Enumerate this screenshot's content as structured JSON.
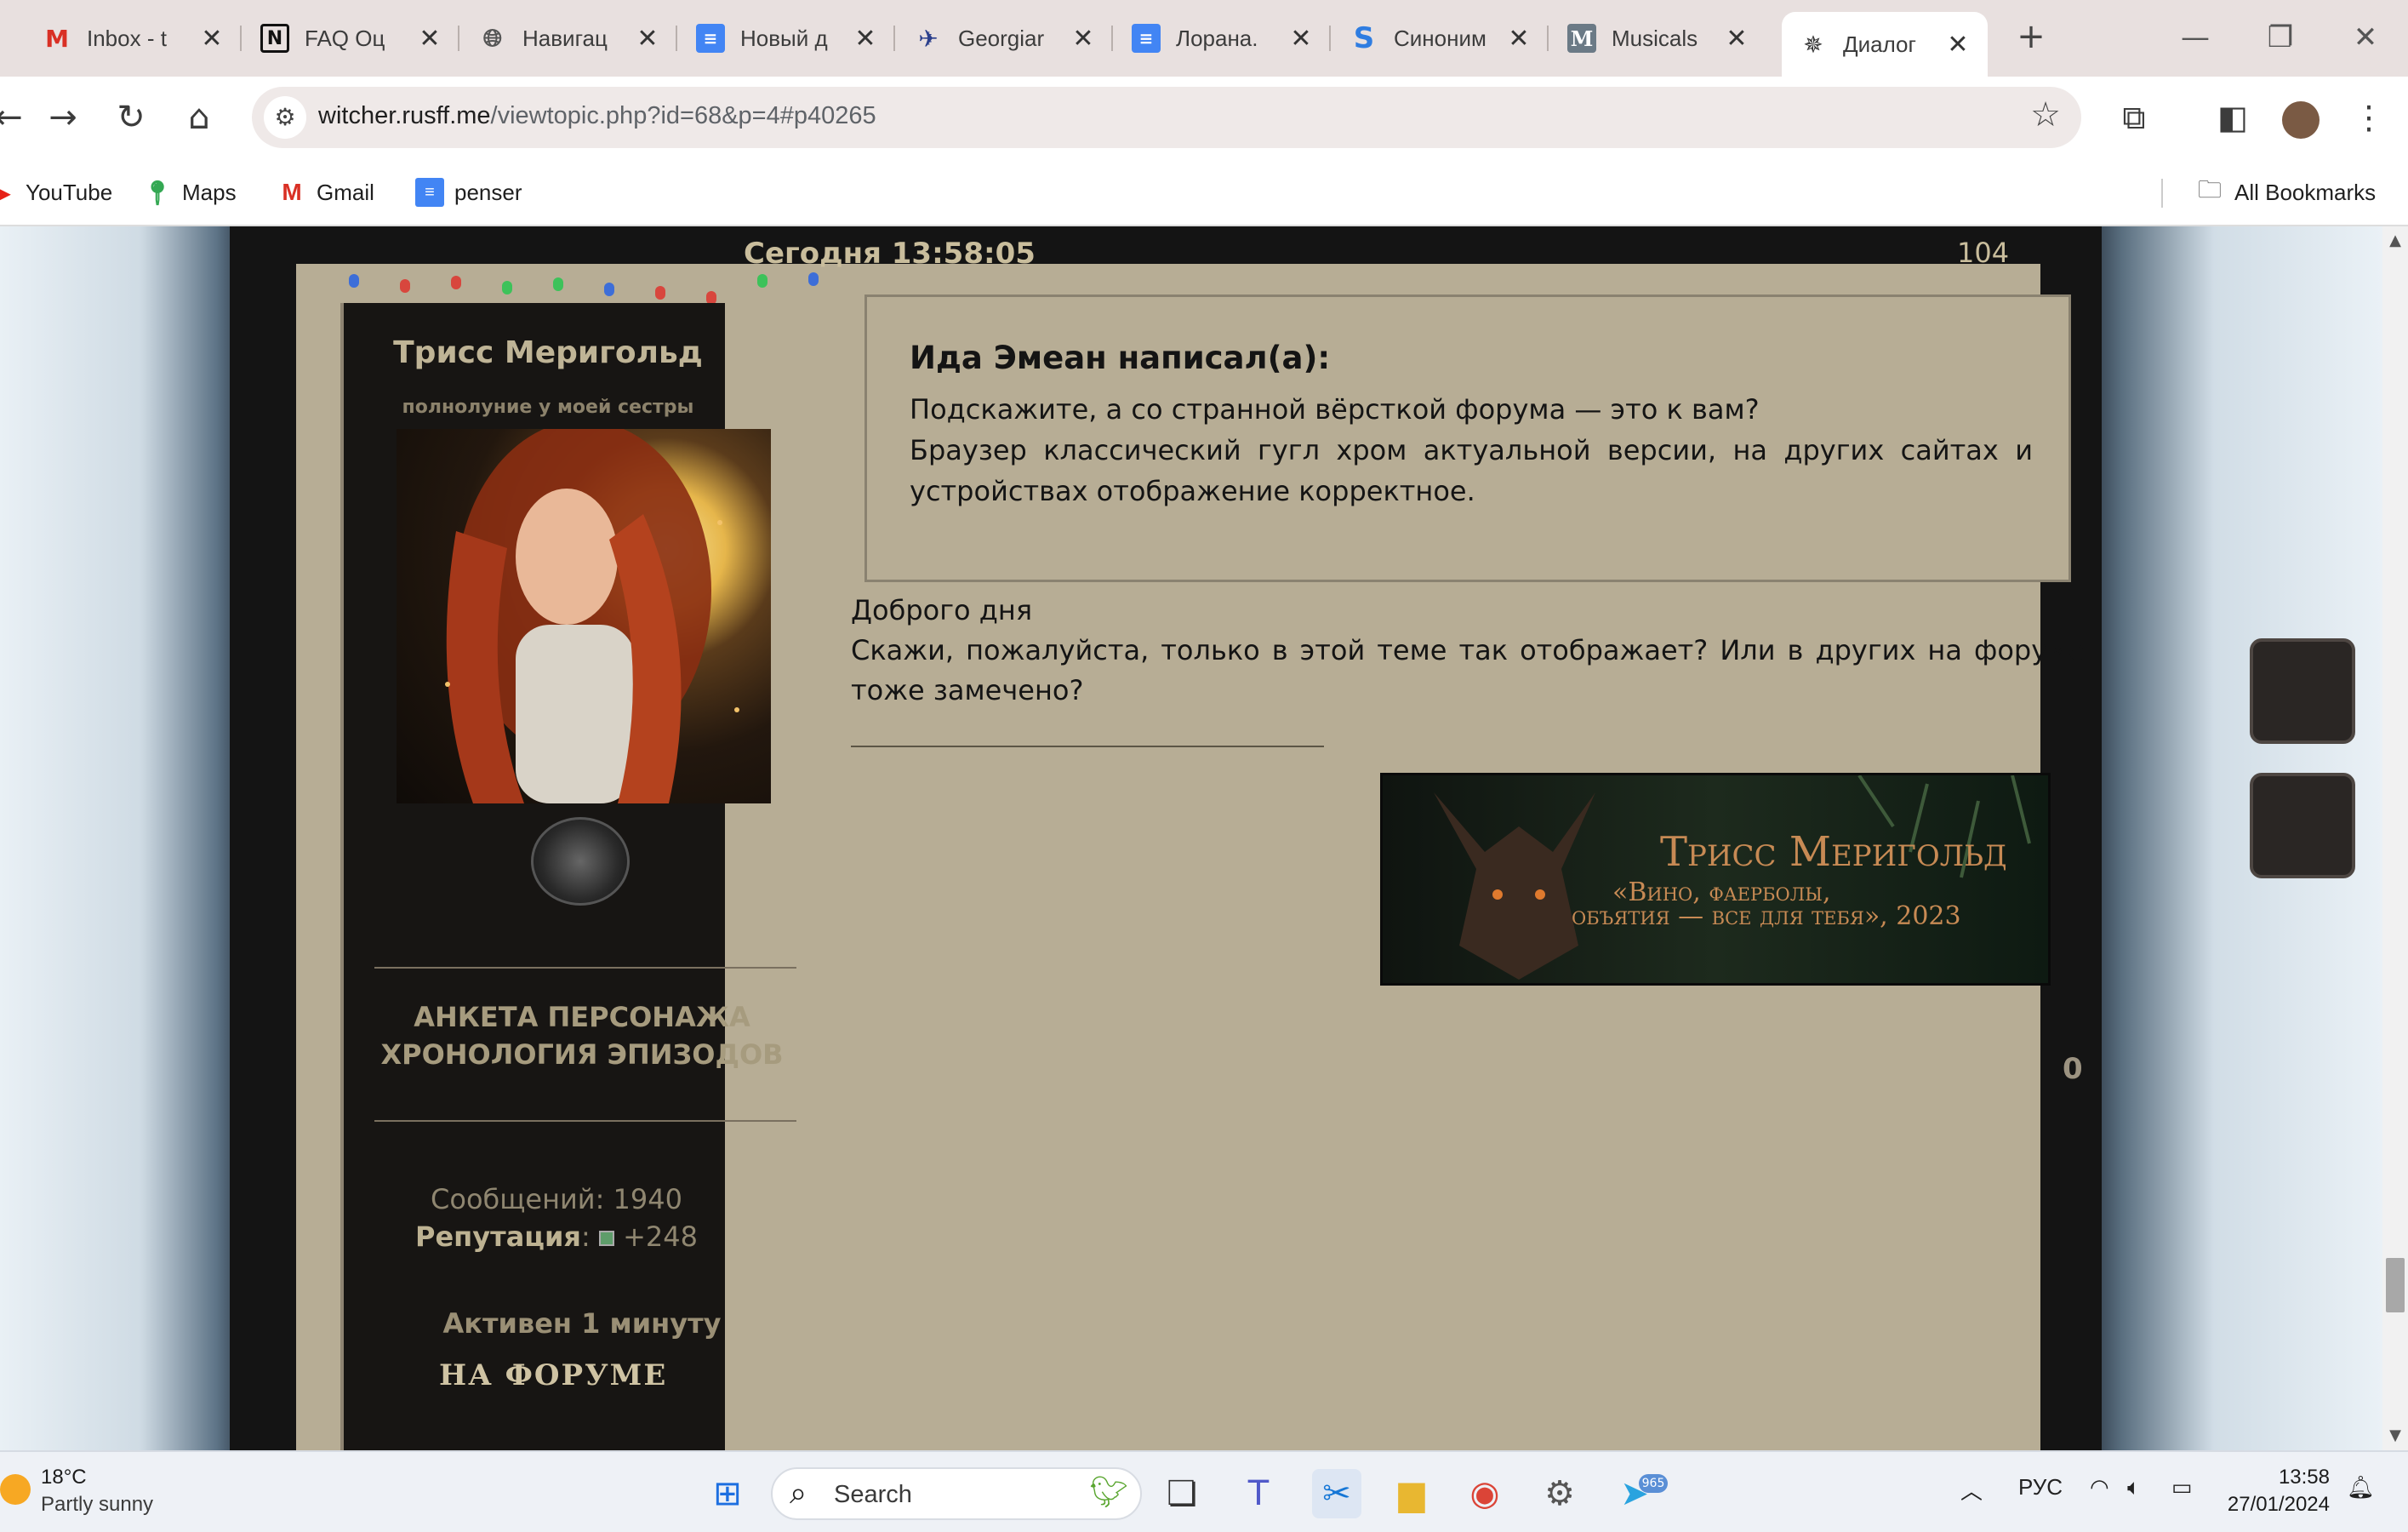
{
  "tabs": [
    {
      "title": "Inbox - t",
      "icon": "gmail-icon"
    },
    {
      "title": "FAQ Оц",
      "icon": "notion-icon"
    },
    {
      "title": "Навигац",
      "icon": "globe-icon"
    },
    {
      "title": "Новый д",
      "icon": "docs-icon"
    },
    {
      "title": "Georgiar",
      "icon": "airline-icon"
    },
    {
      "title": "Лорана.",
      "icon": "docs-icon"
    },
    {
      "title": "Синоним",
      "icon": "synonym-icon"
    },
    {
      "title": "Musicals",
      "icon": "m-icon"
    },
    {
      "title": "Диалог",
      "icon": "witcher-icon",
      "active": true
    }
  ],
  "address": {
    "host": "witcher.rusff.me",
    "path": "/viewtopic.php?id=68&p=4#p40265"
  },
  "bookmarks": [
    {
      "label": "YouTube"
    },
    {
      "label": "Maps"
    },
    {
      "label": "Gmail"
    },
    {
      "label": "penser"
    }
  ],
  "all_bookmarks": "All Bookmarks",
  "forum": {
    "post_date": "Сегодня 13:58:05",
    "post_number": "104",
    "author_name": "Трисс Меригольд",
    "author_status": "полнолуние у моей сестры",
    "links": [
      "АНКЕТА ПЕРСОНАЖА",
      "ХРОНОЛОГИЯ ЭПИЗОДОВ"
    ],
    "messages_label": "Сообщений:",
    "messages_value": "1940",
    "reputation_label": "Репутация",
    "reputation_value": "+248",
    "active_label": "Активен 1 минуту",
    "online_label": "НА ФОРУМЕ",
    "quote_author": "Ида Эмеан написал(а):",
    "quote_line1": "Подскажите, а со странной вёрсткой форума — это к вам?",
    "quote_line2": "Браузер классический гугл хром актуальной версии, на других сайтах и устройствах отображение корректное.",
    "post_line1": "Доброго дня",
    "post_line2": "Скажи, пожалуйста, только в этой теме так отображает? Или в других на форуме тоже замечено?",
    "signature_name": "Трисс Меригольд",
    "signature_quote1": "«Вино, фаерболы,",
    "signature_quote2": "объятия — все для тебя», 2023",
    "counter": "0"
  },
  "taskbar": {
    "weather_temp": "18°C",
    "weather_desc": "Partly sunny",
    "search_label": "Search",
    "language": "РУС",
    "time": "13:58",
    "date": "27/01/2024",
    "telegram_badge": "965"
  }
}
